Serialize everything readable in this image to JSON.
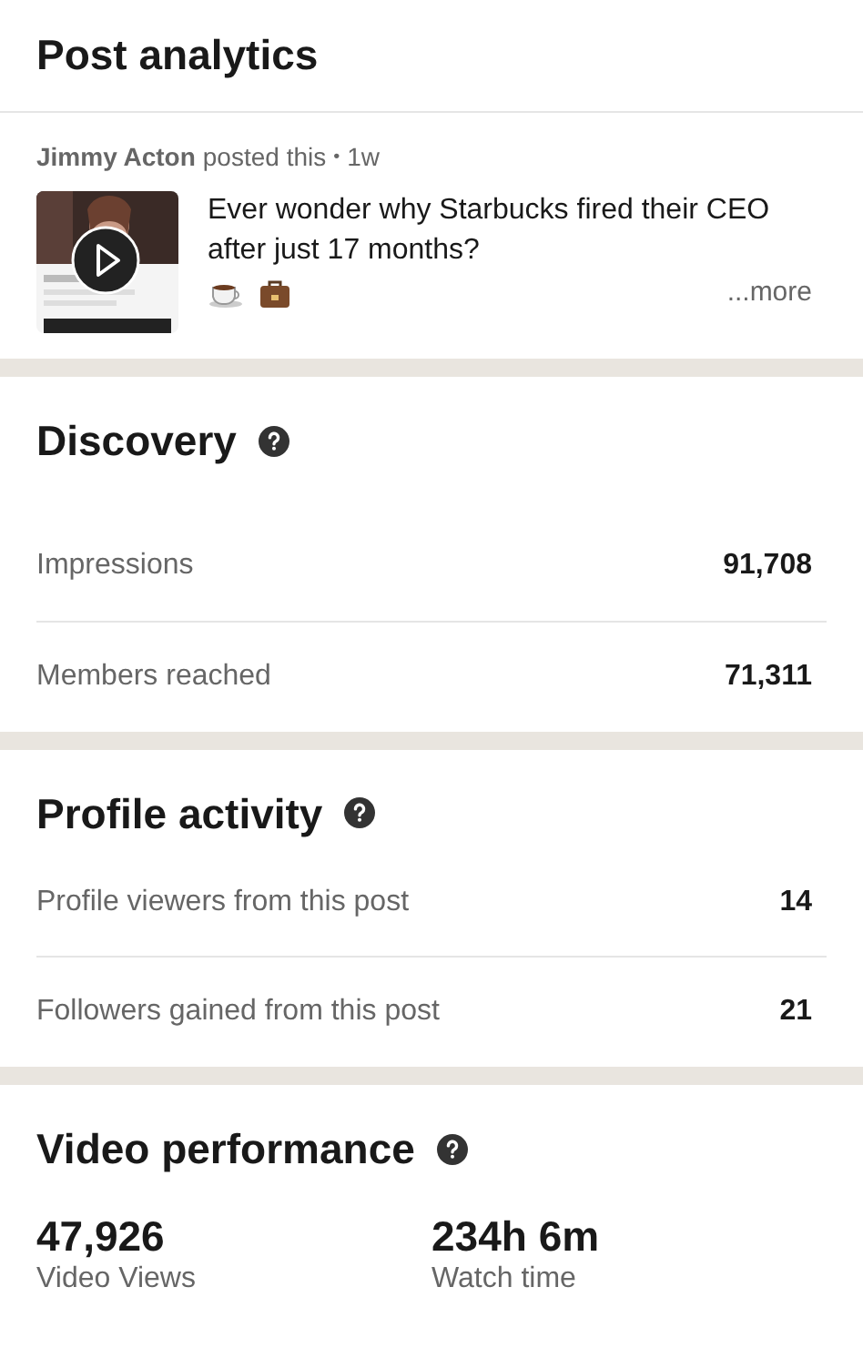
{
  "title": "Post analytics",
  "post": {
    "author": "Jimmy Acton",
    "action": "posted this",
    "separator": "•",
    "age": "1w",
    "text": "Ever wonder why Starbucks fired their CEO after just 17 months?",
    "more": "...more"
  },
  "sections": [
    {
      "kind": "rows",
      "title": "Discovery",
      "rows": [
        {
          "label": "Impressions",
          "value": "91,708"
        },
        {
          "label": "Members reached",
          "value": "71,311"
        }
      ]
    },
    {
      "kind": "rows",
      "title": "Profile activity",
      "rows": [
        {
          "label": "Profile viewers from this post",
          "value": "14"
        },
        {
          "label": "Followers gained from this post",
          "value": "21"
        }
      ]
    },
    {
      "kind": "stats",
      "title": "Video performance",
      "stats": [
        {
          "value": "47,926",
          "label": "Video Views"
        },
        {
          "value": "234h 6m",
          "label": "Watch time"
        }
      ]
    }
  ]
}
